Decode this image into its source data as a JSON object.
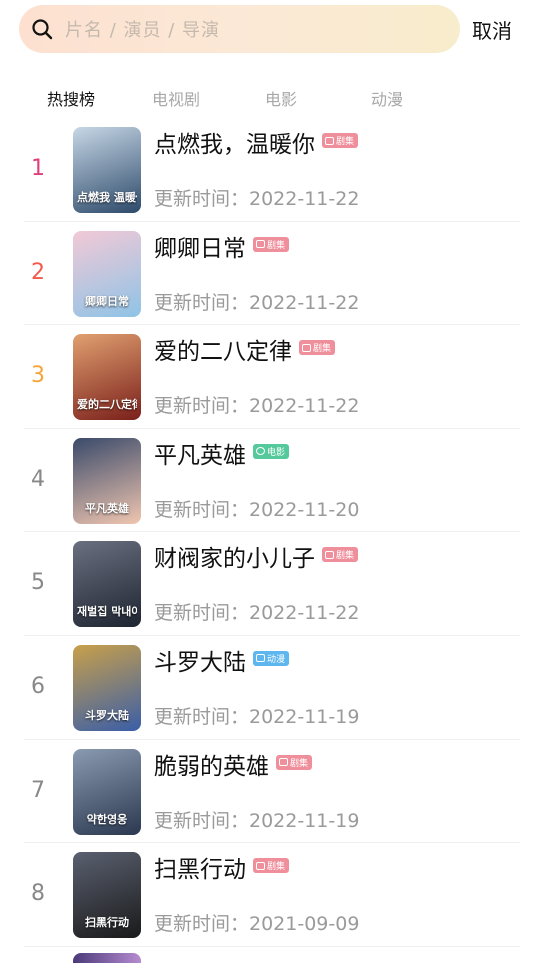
{
  "search": {
    "placeholder": "片名 / 演员 / 导演",
    "cancel_label": "取消",
    "icon": "search-icon"
  },
  "tabs": [
    {
      "label": "热搜榜",
      "active": true
    },
    {
      "label": "电视剧",
      "active": false
    },
    {
      "label": "电影",
      "active": false
    },
    {
      "label": "动漫",
      "active": false
    }
  ],
  "items": [
    {
      "rank": "1",
      "rank_color": "#e0407a",
      "title": "点燃我，温暖你",
      "badge": "剧集",
      "badge_type": "tv",
      "updated": "更新时间：2022-11-22"
    },
    {
      "rank": "2",
      "rank_color": "#f25a4a",
      "title": "卿卿日常",
      "badge": "剧集",
      "badge_type": "tv",
      "updated": "更新时间：2022-11-22"
    },
    {
      "rank": "3",
      "rank_color": "#f6a43a",
      "title": "爱的二八定律",
      "badge": "剧集",
      "badge_type": "tv",
      "updated": "更新时间：2022-11-22"
    },
    {
      "rank": "4",
      "rank_color": "#888888",
      "title": "平凡英雄",
      "badge": "电影",
      "badge_type": "movie",
      "updated": "更新时间：2022-11-20"
    },
    {
      "rank": "5",
      "rank_color": "#888888",
      "title": "财阀家的小儿子",
      "badge": "剧集",
      "badge_type": "tv",
      "updated": "更新时间：2022-11-22"
    },
    {
      "rank": "6",
      "rank_color": "#888888",
      "title": "斗罗大陆",
      "badge": "动漫",
      "badge_type": "anime",
      "updated": "更新时间：2022-11-19"
    },
    {
      "rank": "7",
      "rank_color": "#888888",
      "title": "脆弱的英雄",
      "badge": "剧集",
      "badge_type": "tv",
      "updated": "更新时间：2022-11-19"
    },
    {
      "rank": "8",
      "rank_color": "#888888",
      "title": "扫黑行动",
      "badge": "剧集",
      "badge_type": "tv",
      "updated": "更新时间：2021-09-09"
    }
  ],
  "posters": [
    {
      "g1": "#2d4a6a",
      "g2": "#c7d7e6",
      "cap": "点燃我 温暖你"
    },
    {
      "g1": "#8fc3e6",
      "g2": "#f2c9d6",
      "cap": "卿卿日常"
    },
    {
      "g1": "#7a1f1a",
      "g2": "#e0a070",
      "cap": "爱的二八定律"
    },
    {
      "g1": "#f0c6b0",
      "g2": "#3a4a6a",
      "cap": "平凡英雄"
    },
    {
      "g1": "#1e2430",
      "g2": "#6a7080",
      "cap": "재벌집 막내아들"
    },
    {
      "g1": "#3a5ea8",
      "g2": "#c8a04a",
      "cap": "斗罗大陆"
    },
    {
      "g1": "#2a3850",
      "g2": "#8a9ab0",
      "cap": "약한영웅"
    },
    {
      "g1": "#1a1a1a",
      "g2": "#5a6070",
      "cap": "扫黑行动"
    }
  ]
}
